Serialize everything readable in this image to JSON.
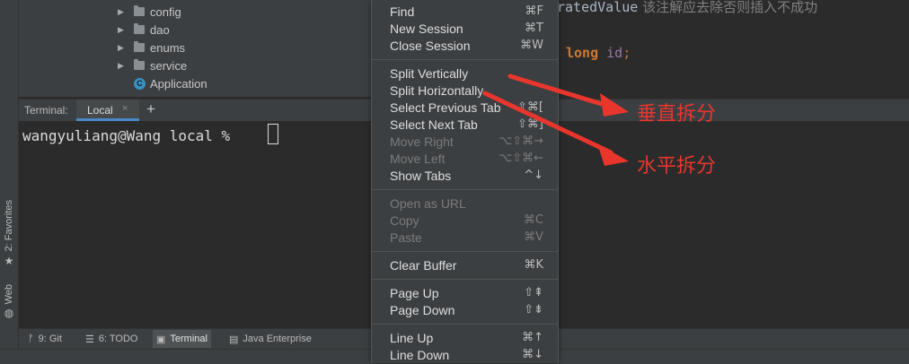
{
  "editor": {
    "line1_code": "ratedValue",
    "line1_comment": " 该注解应去除否则插入不成功",
    "line2_keyword": "long",
    "line2_ident": "id",
    "line2_punct": ";"
  },
  "project_tree": {
    "items": [
      {
        "label": "config",
        "type": "folder"
      },
      {
        "label": "dao",
        "type": "folder"
      },
      {
        "label": "enums",
        "type": "folder"
      },
      {
        "label": "service",
        "type": "folder"
      },
      {
        "label": "Application",
        "type": "class",
        "icon_letter": "C"
      }
    ]
  },
  "left_strip": {
    "favorites_label": "2: Favorites",
    "web_label": "Web"
  },
  "terminal": {
    "title": "Terminal:",
    "tab_label": "Local",
    "tab_close": "×",
    "add_tab": "+",
    "prompt": "wangyuliang@Wang local % "
  },
  "bottom_bar": {
    "tabs": [
      {
        "label": "9: Git",
        "icon": "ᚠ"
      },
      {
        "label": "6: TODO",
        "icon": "☰"
      },
      {
        "label": "Terminal",
        "icon": "▣"
      },
      {
        "label": "Java Enterprise",
        "icon": "▤"
      }
    ]
  },
  "context_menu": {
    "groups": [
      [
        {
          "label": "Find",
          "shortcut": "⌘F",
          "enabled": true
        },
        {
          "label": "New Session",
          "shortcut": "⌘T",
          "enabled": true
        },
        {
          "label": "Close Session",
          "shortcut": "⌘W",
          "enabled": true
        }
      ],
      [
        {
          "label": "Split Vertically",
          "shortcut": "",
          "enabled": true
        },
        {
          "label": "Split Horizontally",
          "shortcut": "",
          "enabled": true
        },
        {
          "label": "Select Previous Tab",
          "shortcut": "⇧⌘[",
          "enabled": true
        },
        {
          "label": "Select Next Tab",
          "shortcut": "⇧⌘]",
          "enabled": true
        },
        {
          "label": "Move Right",
          "shortcut": "⌥⇧⌘→",
          "enabled": false
        },
        {
          "label": "Move Left",
          "shortcut": "⌥⇧⌘←",
          "enabled": false
        },
        {
          "label": "Show Tabs",
          "shortcut": "^↓",
          "enabled": true
        }
      ],
      [
        {
          "label": "Open as URL",
          "shortcut": "",
          "enabled": false
        },
        {
          "label": "Copy",
          "shortcut": "⌘C",
          "enabled": false
        },
        {
          "label": "Paste",
          "shortcut": "⌘V",
          "enabled": false
        }
      ],
      [
        {
          "label": "Clear Buffer",
          "shortcut": "⌘K",
          "enabled": true
        }
      ],
      [
        {
          "label": "Page Up",
          "shortcut": "⇧⇞",
          "enabled": true
        },
        {
          "label": "Page Down",
          "shortcut": "⇧⇟",
          "enabled": true
        }
      ],
      [
        {
          "label": "Line Up",
          "shortcut": "⌘↑",
          "enabled": true
        },
        {
          "label": "Line Down",
          "shortcut": "⌘↓",
          "enabled": true
        }
      ]
    ]
  },
  "annotations": {
    "vertical_split": "垂直拆分",
    "horizontal_split": "水平拆分",
    "color": "#e8362d"
  }
}
